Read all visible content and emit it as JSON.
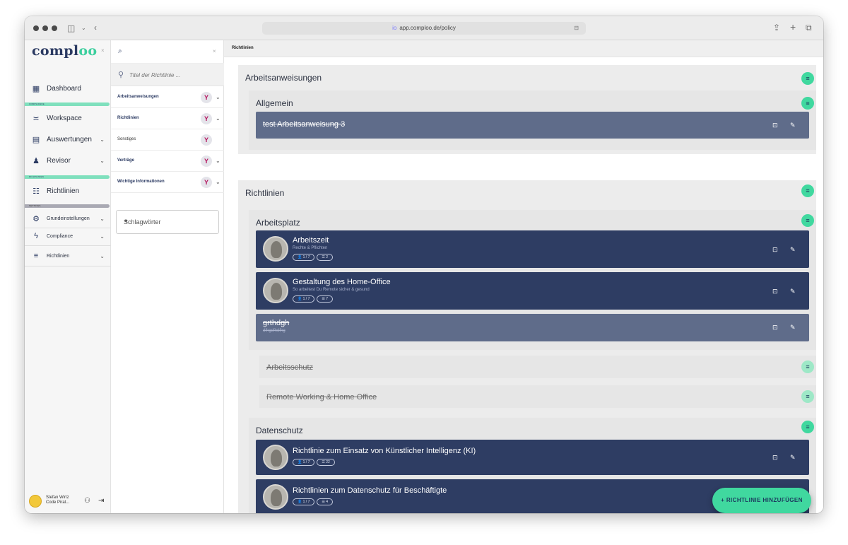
{
  "browser": {
    "url": "app.comploo.de/policy"
  },
  "sidebar": {
    "brand_prefix": "compl",
    "brand_suffix": "oo",
    "close": "×",
    "items": [
      {
        "label": "Dashboard",
        "icon": "dashboard-icon"
      },
      {
        "label": "Workspace",
        "icon": "workspace-icon"
      },
      {
        "label": "Auswertungen",
        "icon": "clipboard-icon"
      },
      {
        "label": "Revisor",
        "icon": "user-check-icon"
      },
      {
        "label": "Richtlinien",
        "icon": "policy-icon"
      },
      {
        "label": "Grundeinstellungen",
        "icon": "gears-icon"
      },
      {
        "label": "Compliance",
        "icon": "bolt-icon"
      },
      {
        "label": "Richtlinien",
        "icon": "list-icon"
      }
    ],
    "sections": {
      "compliance": "COMPLIANCE",
      "richtlinien": "RICHTLINIEN",
      "settings": "SETTINGS"
    },
    "user": {
      "name": "Stefan Wirtz",
      "role": "Code Pirat..."
    }
  },
  "filter": {
    "close": "×",
    "search_placeholder": "Titel der Richtlinie ...",
    "rows": [
      {
        "label": "Arbeitsanweisungen",
        "expandable": true
      },
      {
        "label": "Richtlinien",
        "expandable": true
      },
      {
        "label": "Sonstiges",
        "expandable": false
      },
      {
        "label": "Verträge",
        "expandable": true
      },
      {
        "label": "Wichtige Informationen",
        "expandable": true
      }
    ],
    "tags_placeholder": "Schlagwörter"
  },
  "main": {
    "header": "Richtlinien",
    "categories": [
      {
        "title": "Arbeitsanweisungen"
      },
      {
        "title": "Richtlinien"
      }
    ],
    "subcategories": {
      "allgemein": "Allgemein",
      "arbeitsplatz": "Arbeitsplatz",
      "arbeitsschutz": "Arbeitsschutz",
      "remote": "Remote Working & Home Office",
      "datenschutz": "Datenschutz"
    },
    "cards": [
      {
        "title": "test Arbeitsanweisung 3",
        "subtitle": "",
        "deleted": true
      },
      {
        "title": "Arbeitszeit",
        "subtitle": "Rechte & Pflichten",
        "pill1": "1 / 7",
        "pill2": "2",
        "deleted": false
      },
      {
        "title": "Gestaltung des Home-Office",
        "subtitle": "So arbeitest Du Remote sicher & gesund",
        "pill1": "1 / 7",
        "pill2": "7",
        "deleted": false
      },
      {
        "title": "grthdgh",
        "subtitle": "dfhgdfhdfhg",
        "deleted": true
      },
      {
        "title": "Richtlinie zum Einsatz von Künstlicher Intelligenz (KI)",
        "subtitle": "",
        "pill1": "1 / 7",
        "pill2": "22",
        "deleted": false
      },
      {
        "title": "Richtlinien zum Datenschutz für Beschäftigte",
        "subtitle": "",
        "pill1": "1 / 7",
        "pill2": "4",
        "deleted": false
      }
    ],
    "add_button": "+ RICHTLINIE HINZUFÜGEN"
  }
}
